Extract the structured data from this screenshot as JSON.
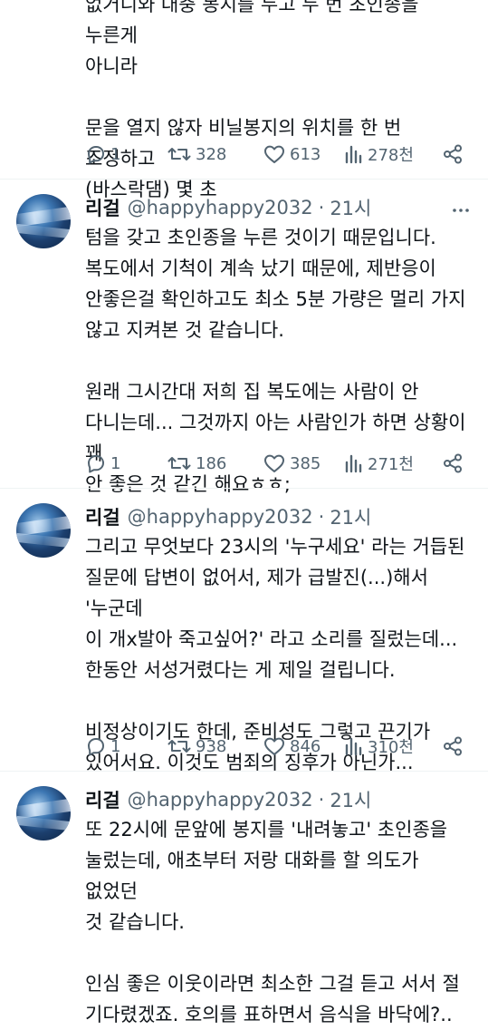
{
  "top_tweet": {
    "text": "없거니와 대충 봉지를 두고 두 번 초인종을 누른게\n아니라\n\n문을 열지 않자 비닐봉지의 위치를 한 번 조정하고\n(바스락댐) 몇 초",
    "replies": "1",
    "retweets": "328",
    "likes": "613",
    "views": "278천"
  },
  "tweets": [
    {
      "name": "리걸",
      "handle": "@happyhappy2032",
      "separator": "·",
      "time": "21시",
      "text": "텀을 갖고 초인종을 누른 것이기 때문입니다.\n복도에서 기척이 계속 났기 때문에, 제반응이\n안좋은걸 확인하고도 최소 5분 가량은 멀리 가지\n않고 지켜본 것 같습니다.\n\n원래 그시간대 저희 집 복도에는 사람이 안\n다니는데... 그것까지 아는 사람인가 하면 상황이 꽤\n안 좋은 것 같긴 해요ㅎㅎ;",
      "replies": "1",
      "retweets": "186",
      "likes": "385",
      "views": "271천"
    },
    {
      "name": "리걸",
      "handle": "@happyhappy2032",
      "separator": "·",
      "time": "21시",
      "text": "그리고 무엇보다 23시의 '누구세요' 라는 거듭된\n질문에 답변이 없어서, 제가 급발진(...)해서 '누군데\n이 개x발아 죽고싶어?' 라고 소리를 질렀는데...\n한동안 서성거렸다는 게 제일 걸립니다.\n\n비정상이기도 한데, 준비성도 그렇고 끈기가\n있어서요. 이것도 범죄의 징후가 아닌가...",
      "replies": "1",
      "retweets": "938",
      "likes": "846",
      "views": "310천"
    },
    {
      "name": "리걸",
      "handle": "@happyhappy2032",
      "separator": "·",
      "time": "21시",
      "text": "또 22시에 문앞에 봉지를 '내려놓고' 초인종을\n눌렀는데, 애초부터 저랑 대화를 할 의도가 없었던\n것 같습니다.\n\n인심 좋은 이웃이라면 최소한 그걸 듣고 서서 절\n기다렸겠죠. 호의를 표하면서 음식을 바닥에?..",
      "replies": "",
      "retweets": "",
      "likes": "",
      "views": ""
    }
  ],
  "icons": {
    "reply": "speech-bubble-icon",
    "retweet": "retweet-arrows-icon",
    "like": "heart-icon",
    "views": "bar-chart-icon",
    "share": "share-nodes-icon",
    "more": "more-dots-icon"
  },
  "colors": {
    "text": "#0f1419",
    "secondary": "#536471",
    "divider": "#eff3f4"
  }
}
